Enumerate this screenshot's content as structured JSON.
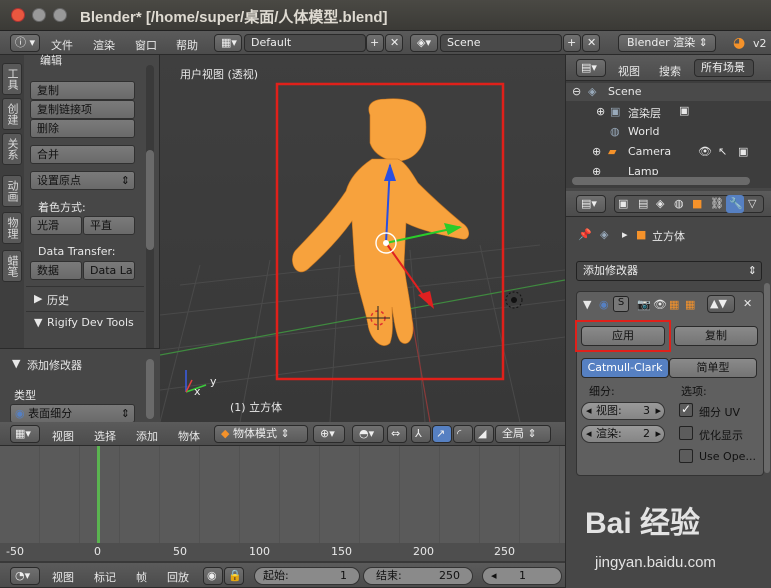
{
  "window": {
    "title": "Blender* [/home/super/桌面/人体模型.blend]"
  },
  "info_header": {
    "menus": [
      "文件",
      "渲染",
      "窗口",
      "帮助"
    ],
    "layout": "Default",
    "scene": "Scene",
    "engine": "Blender 渲染",
    "version": "v2"
  },
  "tool_panel": {
    "tabs": [
      "工具",
      "创建",
      "关系",
      "动画",
      "物理",
      "蜡笔"
    ],
    "section_edit": "编辑",
    "buttons": [
      "复制",
      "复制链接项",
      "删除",
      "合并"
    ],
    "origin_dropdown": "设置原点",
    "shading_label": "着色方式:",
    "smooth": "光滑",
    "flat": "平直",
    "data_transfer_label": "Data Transfer:",
    "data": "数据",
    "data_layers": "Data La",
    "history": "历史",
    "rigify": "Rigify Dev Tools",
    "add_modifier": "添加修改器",
    "type_label": "类型",
    "type_value": "表面细分"
  },
  "viewport": {
    "label": "用户视图 (透视)",
    "object_label": "(1) 立方体",
    "axis_x": "x",
    "axis_y": "y"
  },
  "view3d_header": {
    "menus": [
      "视图",
      "选择",
      "添加",
      "物体"
    ],
    "mode": "物体模式",
    "orientation": "全局"
  },
  "timeline": {
    "ticks": [
      "-50",
      "0",
      "50",
      "100",
      "150",
      "200",
      "250"
    ],
    "menus": [
      "视图",
      "标记",
      "帧",
      "回放"
    ],
    "start_label": "起始:",
    "start_value": "1",
    "end_label": "结束:",
    "end_value": "250",
    "current": "1"
  },
  "outliner": {
    "menus": [
      "视图",
      "搜索"
    ],
    "filter": "所有场景",
    "items": [
      "Scene",
      "渲染层",
      "World",
      "Camera",
      "Lamp"
    ]
  },
  "properties": {
    "breadcrumb": "立方体",
    "add_modifier": "添加修改器",
    "apply": "应用",
    "copy": "复制",
    "catmull": "Catmull-Clark",
    "simple": "简单型",
    "subdiv_label": "细分:",
    "options_label": "选项:",
    "view_label": "视图:",
    "view_value": "3",
    "render_label": "渲染:",
    "render_value": "2",
    "subdiv_uv": "细分 UV",
    "optimal": "优化显示",
    "use_opensubdiv": "Use Ope..."
  },
  "watermark": {
    "brand": "Bai 经验",
    "url": "jingyan.baidu.com"
  },
  "colors": {
    "accent_red": "#e0201a",
    "selected_orange": "#f7a23d",
    "active_blue": "#5680c2"
  }
}
